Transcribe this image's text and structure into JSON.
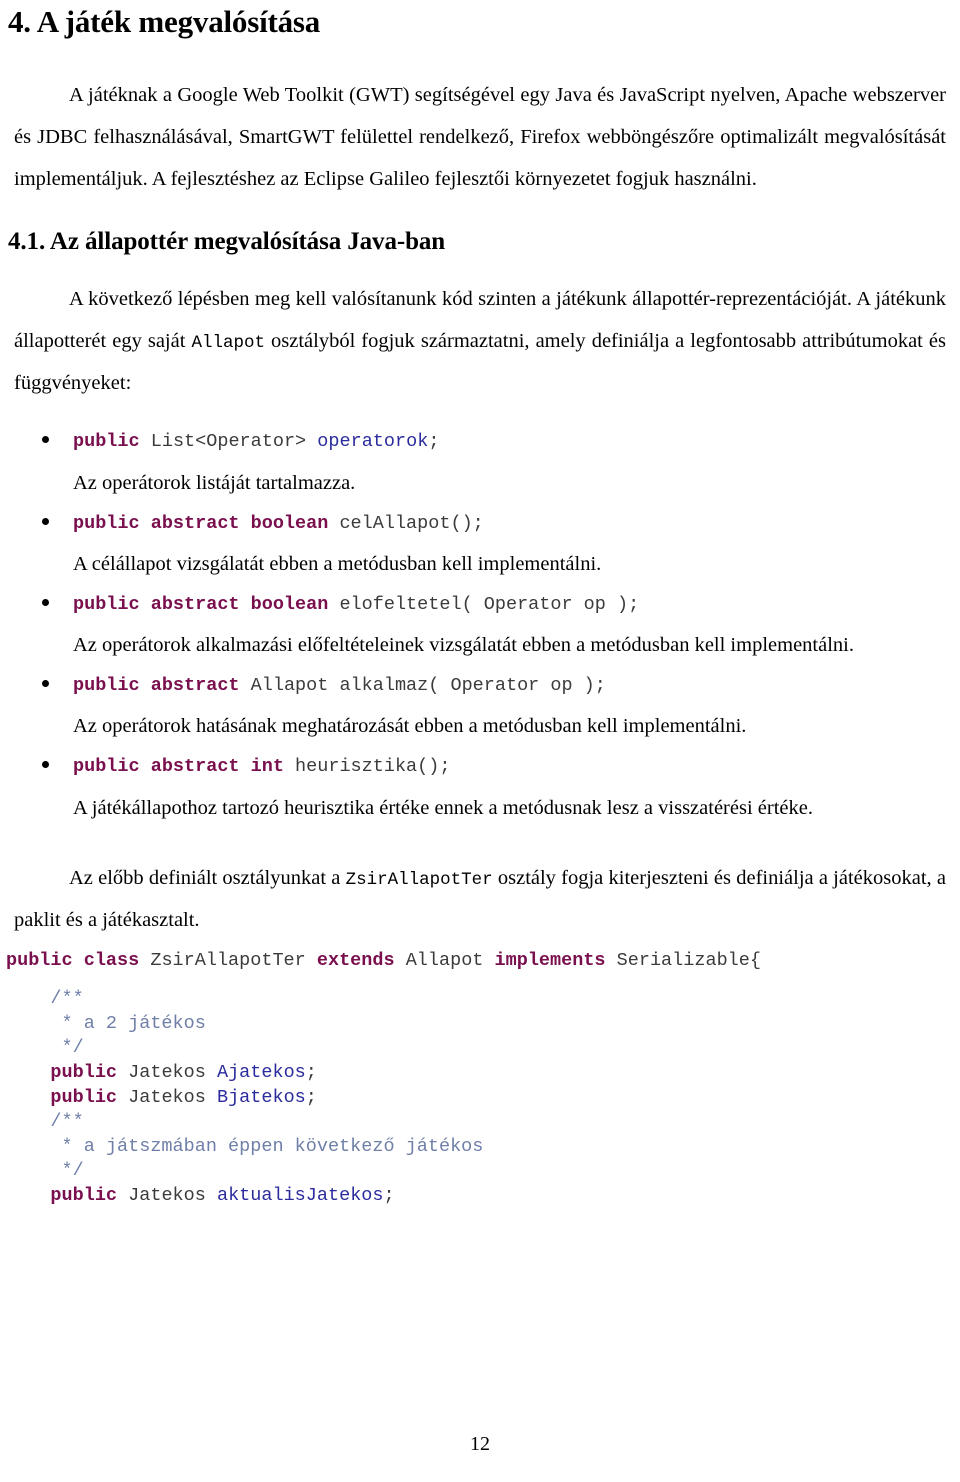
{
  "document": {
    "page_number": "12",
    "colors": {
      "keyword": "#7a0f4e",
      "identifier": "#2b2b9e",
      "comment": "#6f7fa8",
      "code_plain": "#3b3b3b",
      "body_text": "#000000",
      "background": "#ffffff"
    }
  },
  "heading1": "4. A játék megvalósítása",
  "intro_paragraph": "A játéknak a Google Web Toolkit (GWT) segítségével egy Java és JavaScript nyelven, Apache webszerver és JDBC felhasználásával, SmartGWT felülettel rendelkező, Firefox webböngészőre optimalizált megvalósítását implementáljuk. A fejlesztéshez az Eclipse Galileo fejlesztői környezetet fogjuk használni.",
  "heading2": "4.1. Az állapottér megvalósítása Java-ban",
  "section_paragraph": {
    "part1": "A következő lépésben meg kell valósítanunk kód szinten a játékunk állapottér-reprezentációját. A játékunk állapotterét egy saját ",
    "code1": "Allapot",
    "part2": " osztályból fogjuk származtatni, amely definiálja a legfontosabb attribútumokat és függvényeket:"
  },
  "members": [
    {
      "code_tokens": [
        {
          "text": "public",
          "kind": "kw"
        },
        {
          "text": " ",
          "kind": "plain"
        },
        {
          "text": "List<Operator>",
          "kind": "plain"
        },
        {
          "text": " ",
          "kind": "plain"
        },
        {
          "text": "operatorok",
          "kind": "ident"
        },
        {
          "text": ";",
          "kind": "plain"
        }
      ],
      "description": "Az operátorok listáját tartalmazza."
    },
    {
      "code_tokens": [
        {
          "text": "public abstract boolean",
          "kind": "kw"
        },
        {
          "text": " celAllapot();",
          "kind": "plain"
        }
      ],
      "description": "A célállapot vizsgálatát ebben a metódusban kell implementálni."
    },
    {
      "code_tokens": [
        {
          "text": "public abstract boolean",
          "kind": "kw"
        },
        {
          "text": " elofeltetel( Operator op );",
          "kind": "plain"
        }
      ],
      "description": "Az operátorok alkalmazási előfeltételeinek vizsgálatát ebben a metódusban kell implementálni."
    },
    {
      "code_tokens": [
        {
          "text": "public abstract",
          "kind": "kw"
        },
        {
          "text": " Allapot alkalmaz( Operator op );",
          "kind": "plain"
        }
      ],
      "description": "Az operátorok hatásának meghatározását ebben a metódusban kell implementálni."
    },
    {
      "code_tokens": [
        {
          "text": "public abstract int",
          "kind": "kw"
        },
        {
          "text": " heurisztika();",
          "kind": "plain"
        }
      ],
      "description": "A játékállapothoz tartozó heurisztika értéke ennek a metódusnak lesz a visszatérési értéke."
    }
  ],
  "closing_paragraph": {
    "part1": "Az előbb definiált osztályunkat a ",
    "code1": "ZsirAllapotTer",
    "part2": " osztály fogja kiterjeszteni és definiálja a játékosokat, a paklit és a játékasztalt."
  },
  "code_block": {
    "lines": [
      {
        "tokens": [
          {
            "text": "public class",
            "kind": "kw"
          },
          {
            "text": " ZsirAllapotTer ",
            "kind": "plain"
          },
          {
            "text": "extends",
            "kind": "kw"
          },
          {
            "text": " Allapot ",
            "kind": "plain"
          },
          {
            "text": "implements",
            "kind": "kw"
          },
          {
            "text": " Serializable{",
            "kind": "plain"
          }
        ]
      },
      {
        "blank": true
      },
      {
        "tokens": [
          {
            "text": "    /**",
            "kind": "cmt"
          }
        ]
      },
      {
        "tokens": [
          {
            "text": "     * a 2 játékos",
            "kind": "cmt"
          }
        ]
      },
      {
        "tokens": [
          {
            "text": "     */",
            "kind": "cmt"
          }
        ]
      },
      {
        "tokens": [
          {
            "text": "    ",
            "kind": "plain"
          },
          {
            "text": "public",
            "kind": "kw"
          },
          {
            "text": " Jatekos ",
            "kind": "plain"
          },
          {
            "text": "Ajatekos",
            "kind": "ident"
          },
          {
            "text": ";",
            "kind": "plain"
          }
        ]
      },
      {
        "tokens": [
          {
            "text": "    ",
            "kind": "plain"
          },
          {
            "text": "public",
            "kind": "kw"
          },
          {
            "text": " Jatekos ",
            "kind": "plain"
          },
          {
            "text": "Bjatekos",
            "kind": "ident"
          },
          {
            "text": ";",
            "kind": "plain"
          }
        ]
      },
      {
        "tokens": [
          {
            "text": "    /**",
            "kind": "cmt"
          }
        ]
      },
      {
        "tokens": [
          {
            "text": "     * a játszmában éppen következő játékos",
            "kind": "cmt"
          }
        ]
      },
      {
        "tokens": [
          {
            "text": "     */",
            "kind": "cmt"
          }
        ]
      },
      {
        "tokens": [
          {
            "text": "    ",
            "kind": "plain"
          },
          {
            "text": "public",
            "kind": "kw"
          },
          {
            "text": " Jatekos ",
            "kind": "plain"
          },
          {
            "text": "aktualisJatekos",
            "kind": "ident"
          },
          {
            "text": ";",
            "kind": "plain"
          }
        ]
      }
    ]
  }
}
